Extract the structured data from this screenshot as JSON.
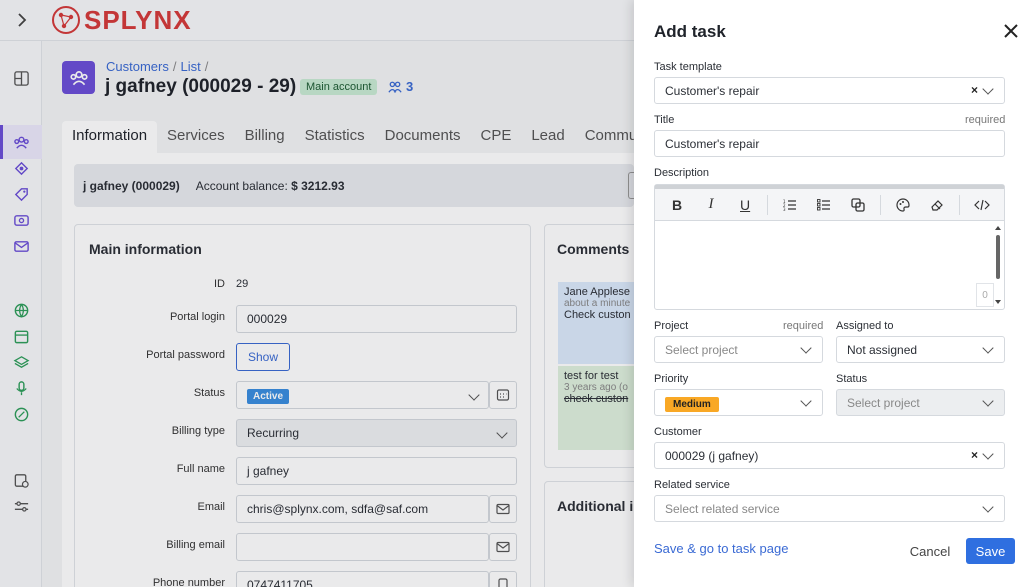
{
  "app": {
    "logo_text": "SPLYNX"
  },
  "breadcrumb": {
    "customers": "Customers",
    "sep": "/",
    "list": "List",
    "trail": "/"
  },
  "customer": {
    "title": "j gafney (000029 - 29)",
    "main_badge": "Main account",
    "users_count": "3"
  },
  "tabs": [
    "Information",
    "Services",
    "Billing",
    "Statistics",
    "Documents",
    "CPE",
    "Lead",
    "Commun"
  ],
  "balance": {
    "name": "j gafney (000029)",
    "label": "Account balance:",
    "value": "$ 3212.93"
  },
  "main_info": {
    "title": "Main information",
    "fields": {
      "id_label": "ID",
      "id_value": "29",
      "portal_login_label": "Portal login",
      "portal_login_value": "000029",
      "portal_password_label": "Portal password",
      "portal_password_button": "Show",
      "status_label": "Status",
      "status_value": "Active",
      "billing_type_label": "Billing type",
      "billing_type_value": "Recurring",
      "full_name_label": "Full name",
      "full_name_value": "j gafney",
      "email_label": "Email",
      "email_value": "chris@splynx.com, sdfa@saf.com",
      "billing_email_label": "Billing email",
      "billing_email_value": "",
      "phone_label": "Phone number",
      "phone_value": "0747411705"
    }
  },
  "comments": {
    "title": "Comments",
    "items": [
      {
        "author": "Jane Applese",
        "time": "about a minute",
        "text": "Check custon"
      },
      {
        "author": "test for test",
        "time": "3 years ago (o",
        "text": "check custon"
      }
    ]
  },
  "additional": {
    "title": "Additional i"
  },
  "panel": {
    "title": "Add task",
    "task_template_label": "Task template",
    "task_template_value": "Customer's repair",
    "title_label": "Title",
    "required": "required",
    "title_value": "Customer's repair",
    "description_label": "Description",
    "char_counter": "0",
    "project_label": "Project",
    "project_placeholder": "Select project",
    "assigned_label": "Assigned to",
    "assigned_value": "Not assigned",
    "priority_label": "Priority",
    "priority_value": "Medium",
    "status_label": "Status",
    "status_placeholder": "Select project",
    "customer_label": "Customer",
    "customer_value": "000029 (j gafney)",
    "related_label": "Related service",
    "related_placeholder": "Select related service",
    "save_go": "Save & go to task page",
    "cancel": "Cancel",
    "save": "Save"
  },
  "colors": {
    "accent": "#6b4fd8",
    "brand": "#d53a3a",
    "primary": "#2f6fe0",
    "priority": "#f9a825",
    "active": "#3a8de0"
  }
}
